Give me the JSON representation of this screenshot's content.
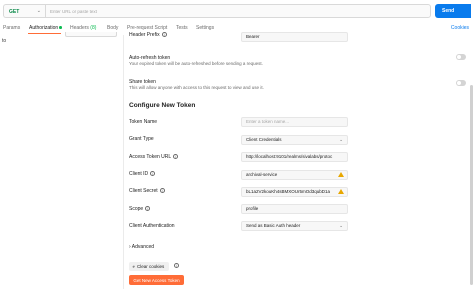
{
  "request": {
    "method": "GET",
    "url_value": "",
    "url_placeholder": "Enter URL or paste text",
    "send_label": "Send"
  },
  "tabs": {
    "params": "Params",
    "authorization": "Authorization",
    "headers": "Headers",
    "headers_count": "(8)",
    "body": "Body",
    "prerequest": "Pre-request Script",
    "tests": "Tests",
    "settings": "Settings",
    "cookies": "Cookies"
  },
  "left_pane": {
    "text": "to"
  },
  "auth": {
    "header_prefix_label": "Header Prefix",
    "header_prefix_value": "Bearer",
    "auto_refresh_label": "Auto-refresh token",
    "auto_refresh_desc": "Your expired token will be auto-refreshed before sending a request.",
    "share_token_label": "Share token",
    "share_token_desc": "This will allow anyone with access to this request to view and use it.",
    "section_title": "Configure New Token",
    "token_name_label": "Token Name",
    "token_name_placeholder": "Enter a token name...",
    "grant_type_label": "Grant Type",
    "grant_type_value": "Client Credentials",
    "access_token_url_label": "Access Token URL",
    "access_token_url_value": "http://localhost:9101/realms/sivalabs/protoc",
    "client_id_label": "Client ID",
    "client_id_value": "archival-service",
    "client_secret_label": "Client Secret",
    "client_secret_value": "bL1a2V2kouKh4sBMXOUr5mOd3qubD1a",
    "scope_label": "Scope",
    "scope_value": "profile",
    "client_auth_label": "Client Authentication",
    "client_auth_value": "Send as Basic Auth header",
    "advanced_label": "Advanced",
    "clear_cookies_label": "Clear cookies",
    "get_token_label": "Get New Access Token"
  },
  "icons": {
    "chevron_down": "chevron-down-icon",
    "chevron_right": "chevron-right-icon",
    "info": "info-icon",
    "warning": "warning-icon",
    "cookie": "cookie-icon"
  },
  "colors": {
    "accent_orange": "#ff6c37",
    "send_blue": "#097bed",
    "method_green": "#0b8a4a",
    "warning": "#e8a700"
  }
}
